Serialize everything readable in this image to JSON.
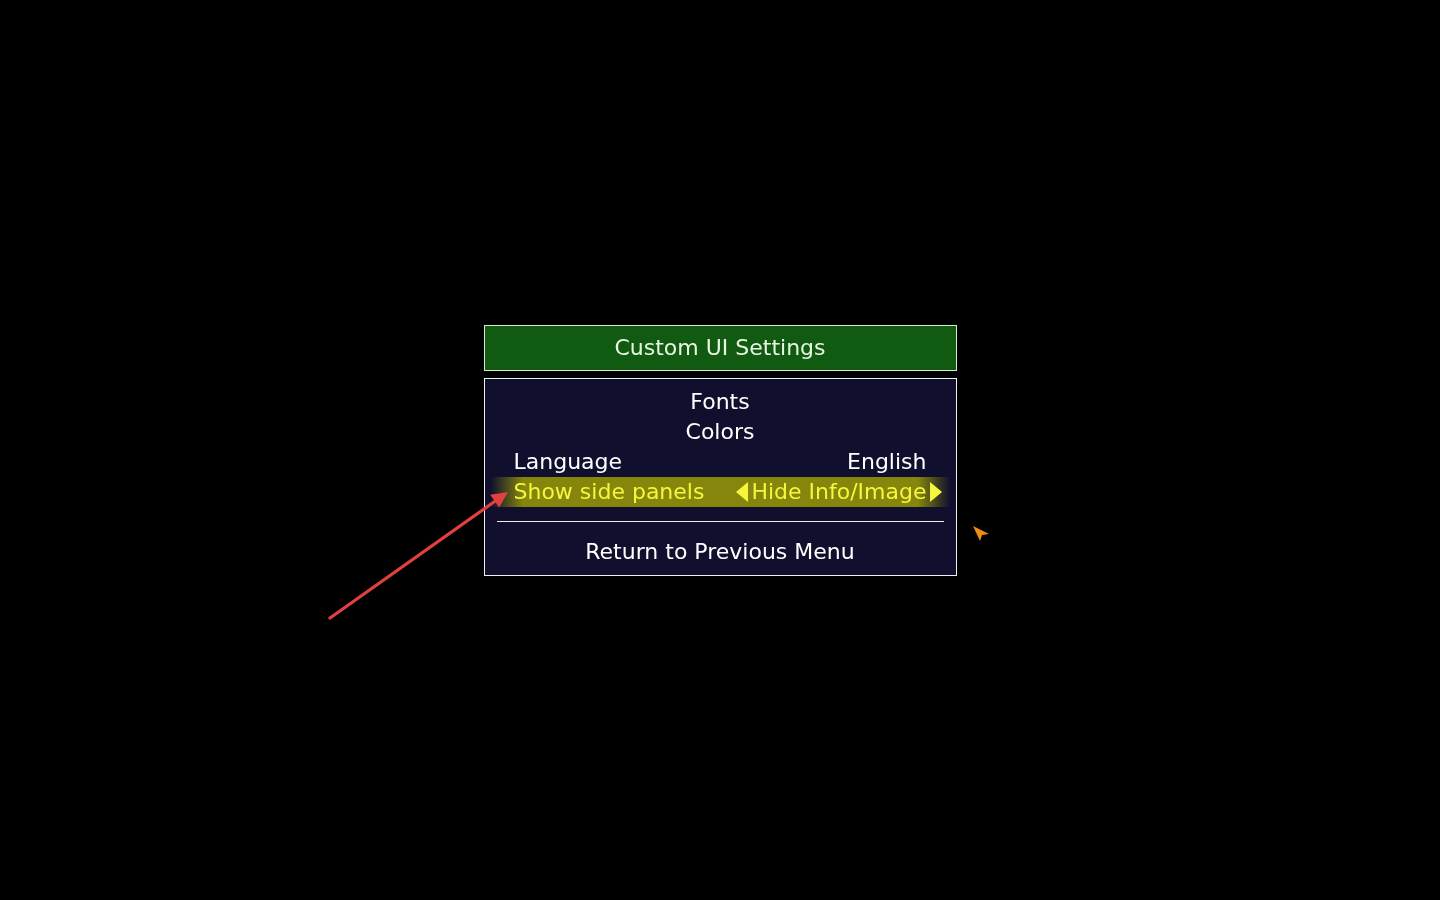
{
  "title": "Custom UI Settings",
  "menu": {
    "items": [
      {
        "kind": "link",
        "label": "Fonts",
        "selected": false
      },
      {
        "kind": "link",
        "label": "Colors",
        "selected": false
      },
      {
        "kind": "option",
        "label": "Language",
        "value": "English",
        "selected": false
      },
      {
        "kind": "option",
        "label": "Show side panels",
        "value": "Hide Info/Image",
        "selected": true
      },
      {
        "kind": "back",
        "label": "Return to Previous Menu",
        "selected": false
      }
    ]
  }
}
